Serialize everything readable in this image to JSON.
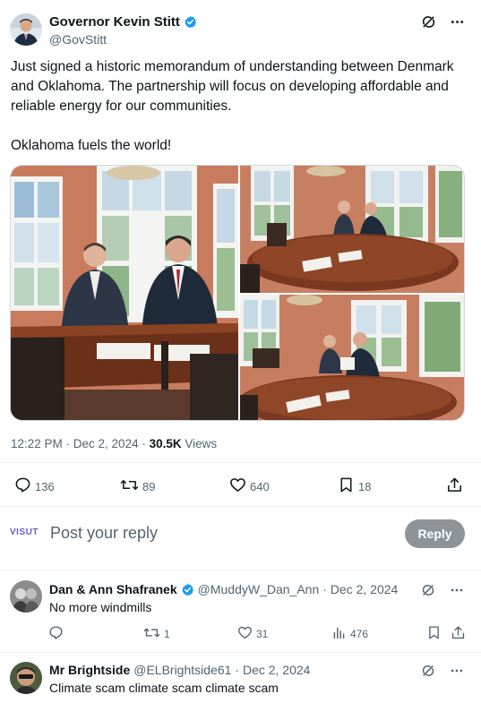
{
  "post": {
    "author_name": "Governor Kevin Stitt",
    "author_handle": "@GovStitt",
    "text_line1": "Just signed a historic memorandum of understanding between Denmark",
    "text_line2": "and Oklahoma. The partnership will focus on developing affordable and",
    "text_line3": "reliable energy for our communities.",
    "text_line4": "Oklahoma fuels the world!",
    "time": "12:22 PM · Dec 2, 2024 · ",
    "views_count": "30.5K",
    "views_label": " Views",
    "stats": {
      "replies": "136",
      "reposts": "89",
      "likes": "640",
      "bookmarks": "18"
    }
  },
  "reply_box": {
    "avatar_text": "VISUT",
    "placeholder": "Post your reply",
    "button_label": "Reply"
  },
  "comments": [
    {
      "name": "Dan & Ann Shafranek",
      "handle": "@MuddyW_Dan_Ann",
      "date": "· Dec 2, 2024",
      "text": "No more windmills",
      "reposts": "1",
      "likes": "31",
      "views": "476"
    },
    {
      "name": "Mr Brightside",
      "handle": "@ELBrightside61",
      "date": "· Dec 2, 2024",
      "text": "Climate scam climate scam climate scam"
    }
  ],
  "colors": {
    "verified": "#1d9bf0",
    "secondary_text": "#536471",
    "reply_button": "#8e9398"
  },
  "icons": {
    "verified": "verified-badge-icon",
    "grok": "grok-icon",
    "more": "more-icon",
    "reply": "reply-icon",
    "repost": "repost-icon",
    "like": "like-icon",
    "bookmark": "bookmark-icon",
    "share": "share-icon",
    "views": "views-icon"
  }
}
